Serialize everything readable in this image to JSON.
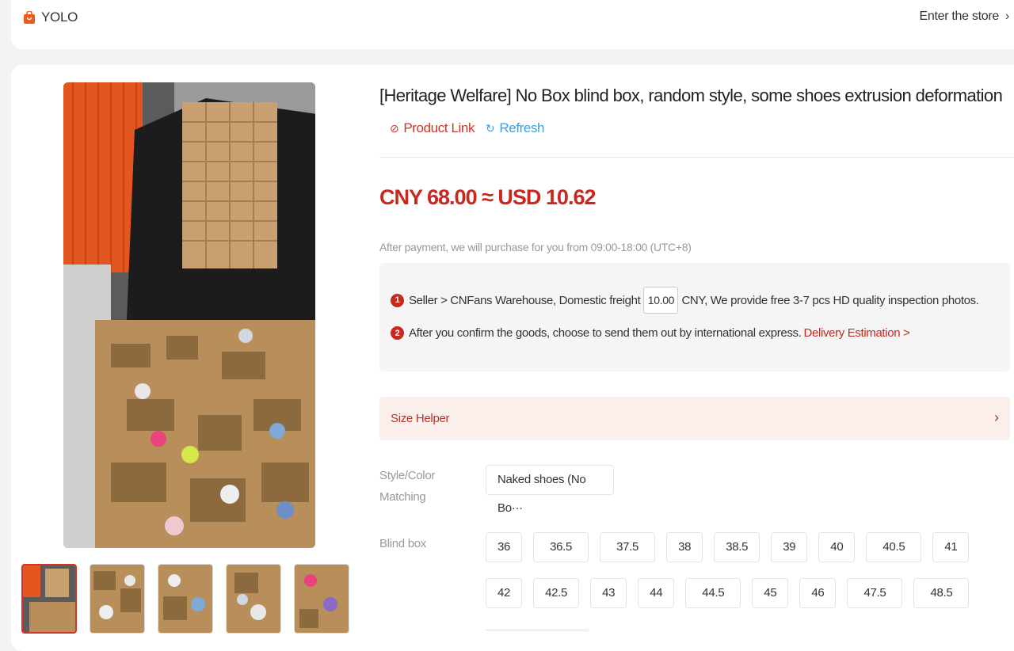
{
  "store": {
    "name": "YOLO",
    "enter_label": "Enter the store",
    "chevron": "›",
    "icon": "shopping-bag-icon"
  },
  "product": {
    "title": "[Heritage Welfare] No Box blind box, random style, some shoes extrusion deformation",
    "link_label": "Product Link",
    "refresh_label": "Refresh",
    "price": "CNY 68.00 ≈ USD 10.62",
    "purchase_note": "After payment, we will purchase for you from 09:00-18:00 (UTC+8)"
  },
  "info": {
    "step1_num": "1",
    "step1_before": "Seller > CNFans Warehouse, Domestic freight",
    "freight_value": "10.00",
    "step1_after": "CNY, We provide free 3-7 pcs HD quality inspection photos.",
    "step2_num": "2",
    "step2_text": "After you confirm the goods, choose to send them out by international express.",
    "delivery_link": "Delivery Estimation >"
  },
  "size_helper": {
    "label": "Size Helper",
    "chevron": "›"
  },
  "options": {
    "style_label": "Style/Color Matching",
    "style_value": "Naked shoes (No Bo···",
    "blind_label": "Blind box",
    "sizes": [
      "36",
      "36.5",
      "37.5",
      "38",
      "38.5",
      "39",
      "40",
      "40.5",
      "41",
      "42",
      "42.5",
      "43",
      "44",
      "44.5",
      "45",
      "46",
      "47.5",
      "48.5"
    ]
  },
  "colors": {
    "accent": "#c8281e",
    "link_blue": "#3a9fe0",
    "size_helper_bg": "#fbefec"
  }
}
